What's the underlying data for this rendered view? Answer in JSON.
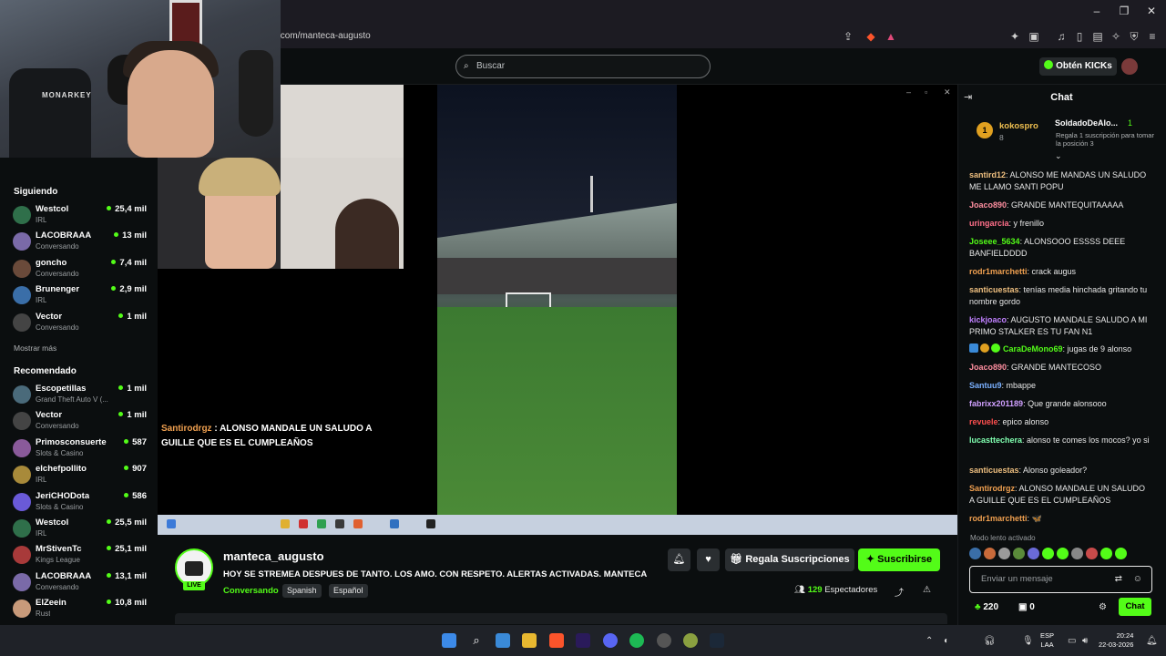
{
  "browser": {
    "url": "k.com/manteca-augusto"
  },
  "header": {
    "search_placeholder": "Buscar",
    "kicks_button": "Obtén KICKs"
  },
  "sidebar": {
    "following_heading": "Siguiendo",
    "following": [
      {
        "name": "Westcol",
        "category": "IRL",
        "viewers": "25,4 mil",
        "color": "#2f6f4a"
      },
      {
        "name": "LACOBRAAA",
        "category": "Conversando",
        "viewers": "13 mil",
        "color": "#7a6aa8"
      },
      {
        "name": "goncho",
        "category": "Conversando",
        "viewers": "7,4 mil",
        "color": "#6a4a3a"
      },
      {
        "name": "Brunenger",
        "category": "IRL",
        "viewers": "2,9 mil",
        "color": "#3a6ea8"
      },
      {
        "name": "Vector",
        "category": "Conversando",
        "viewers": "1 mil",
        "color": "#444"
      }
    ],
    "show_more": "Mostrar más",
    "recommended_heading": "Recomendado",
    "recommended": [
      {
        "name": "Escopetillas",
        "category": "Grand Theft Auto V (...",
        "viewers": "1 mil",
        "color": "#4a6a7a"
      },
      {
        "name": "Vector",
        "category": "Conversando",
        "viewers": "1 mil",
        "color": "#444"
      },
      {
        "name": "Primosconsuerte",
        "category": "Slots & Casino",
        "viewers": "587",
        "color": "#8a5a9a"
      },
      {
        "name": "elchefpollito",
        "category": "IRL",
        "viewers": "907",
        "color": "#a88a3a"
      },
      {
        "name": "JeriCHODota",
        "category": "Slots & Casino",
        "viewers": "586",
        "color": "#6a5ad8"
      },
      {
        "name": "Westcol",
        "category": "IRL",
        "viewers": "25,5 mil",
        "color": "#2f6f4a"
      },
      {
        "name": "MrStivenTc",
        "category": "Kings League",
        "viewers": "25,1 mil",
        "color": "#a83a3a"
      },
      {
        "name": "LACOBRAAA",
        "category": "Conversando",
        "viewers": "13,1 mil",
        "color": "#7a6aa8"
      },
      {
        "name": "ElZeein",
        "category": "Rust",
        "viewers": "10,8 mil",
        "color": "#c89a7a"
      }
    ]
  },
  "webcam": {
    "chair_brand": "MONARKEY"
  },
  "overlay_chat": {
    "user": "Santirodrgz",
    "text": " : ALONSO MANDALE UN SALUDO A GUILLE QUE ES EL CUMPLEAÑOS"
  },
  "stream": {
    "channel": "manteca_augusto",
    "live": "LIVE",
    "title": "HOY SE STREMEA DESPUES DE TANTO. LOS AMO. CON RESPETO. ALERTAS ACTIVADAS. MANTECA",
    "category": "Conversando",
    "tags": [
      "Spanish",
      "Español"
    ],
    "gift_button": "Regala Suscripciones",
    "subscribe_button": "Suscribirse",
    "viewers_count": "129",
    "viewers_label": " Espectadores"
  },
  "chat": {
    "title": "Chat",
    "pinned": {
      "rank": "1",
      "user1": "kokospro",
      "user1_count": "8",
      "user2": "SoldadoDeAlo...",
      "user2_count": "1",
      "gift_text": "Regala 1 suscripción para tomar la posición 3"
    },
    "messages": [
      {
        "user": "santird12",
        "color": "#f0c080",
        "text": ": ALONSO ME MANDAS UN SALUDO ME LLAMO SANTI POPU"
      },
      {
        "user": "Joaco890",
        "color": "#ff8fa0",
        "text": ": GRANDE MANTEQUITAAAAA"
      },
      {
        "user": "uringarcia",
        "color": "#ff6f8a",
        "text": ": y frenillo"
      },
      {
        "user": "Joseee_5634",
        "color": "#53fc18",
        "text": ": ALONSOOO ESSSS DEEE BANFIELDDDD"
      },
      {
        "user": "rodr1marchetti",
        "color": "#f0a050",
        "text": ": crack augus"
      },
      {
        "user": "santicuestas",
        "color": "#f0c080",
        "text": ": tenías media hinchada gritando tu nombre gordo"
      },
      {
        "user": "kickjoaco",
        "color": "#c080ff",
        "text": ": AUGUSTO MANDALE SALUDO A MI PRIMO STALKER ES TU FAN N1"
      },
      {
        "user": "CaraDeMono69",
        "color": "#53fc18",
        "text": ": jugas de 9 alonso"
      },
      {
        "user": "Joaco890",
        "color": "#ff8fa0",
        "text": ": GRANDE MANTECOSO"
      },
      {
        "user": "Santuu9",
        "color": "#7ab0ff",
        "text": ": mbappe"
      },
      {
        "user": "fabrixx201189",
        "color": "#d0a0ff",
        "text": ": Que grande alonsooo"
      },
      {
        "user": "revuele",
        "color": "#ff4f4f",
        "text": ": epico alonso"
      },
      {
        "user": "lucasttechera",
        "color": "#80ffb0",
        "text": ": alonso te comes los mocos? yo si"
      },
      {
        "user": "santicuestas",
        "color": "#f0c080",
        "text": ": Alonso goleador?"
      },
      {
        "user": "Santirodrgz",
        "color": "#f0a050",
        "text": ": ALONSO MANDALE UN SALUDO A GUILLE QUE ES EL CUMPLEAÑOS"
      },
      {
        "user": "rodr1marchetti",
        "color": "#f0a050",
        "text": ": 🦋"
      }
    ],
    "slow_mode": "Modo lento activado",
    "input_placeholder": "Enviar un mensaje",
    "kicks_balance": "220",
    "bag_count": "0",
    "send_button": "Chat"
  },
  "taskbar": {
    "lang_top": "ESP",
    "lang_bottom": "LAA",
    "time": "20:24",
    "date": "22-03-2026"
  }
}
